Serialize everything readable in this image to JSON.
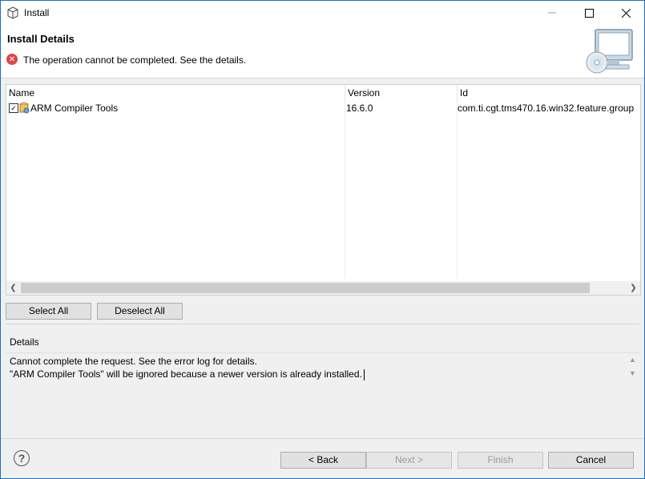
{
  "window": {
    "title": "Install",
    "controls": {
      "minimize": "minimize-icon",
      "maximize": "maximize-icon",
      "close": "close-icon"
    }
  },
  "header": {
    "title": "Install Details",
    "message": "The operation cannot be completed.  See the details.",
    "status_icon": "error-icon",
    "banner_icon": "computer-cd-icon"
  },
  "table": {
    "columns": {
      "name": "Name",
      "version": "Version",
      "id": "Id"
    },
    "rows": [
      {
        "checked": true,
        "name": "ARM Compiler Tools",
        "version": "16.6.0",
        "id": "com.ti.cgt.tms470.16.win32.feature.group"
      }
    ]
  },
  "selection_buttons": {
    "select_all": "Select All",
    "deselect_all": "Deselect All"
  },
  "details": {
    "label": "Details",
    "line1": "Cannot complete the request.  See the error log for details.",
    "line2": "\"ARM Compiler Tools\" will be ignored because a newer version is already installed."
  },
  "footer": {
    "help_icon": "help-icon",
    "back": "< Back",
    "next": "Next >",
    "finish": "Finish",
    "cancel": "Cancel"
  },
  "colors": {
    "accent": "#1e6fc7",
    "error": "#e0454a"
  }
}
